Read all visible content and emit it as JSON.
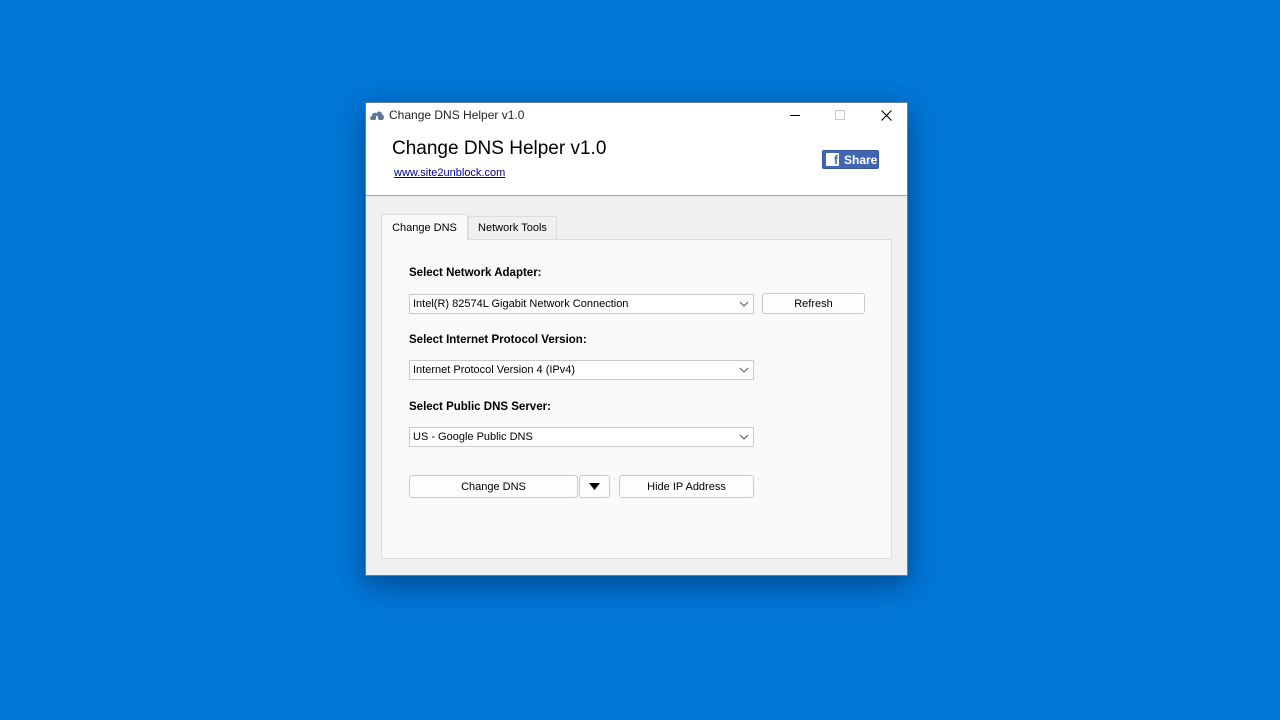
{
  "window": {
    "title": "Change DNS Helper v1.0",
    "icon": "cloud-icon",
    "controls": {
      "minimize": "minimize-icon",
      "maximize": "maximize-icon",
      "close": "close-icon"
    }
  },
  "header": {
    "title": "Change DNS Helper v1.0",
    "link": "www.site2unblock.com",
    "share_label": "Share",
    "share_icon": "facebook-icon",
    "share_color": "#4267b2"
  },
  "tabs": [
    {
      "label": "Change DNS",
      "active": true
    },
    {
      "label": "Network Tools",
      "active": false
    }
  ],
  "form": {
    "adapter_label": "Select Network Adapter:",
    "adapter_value": "Intel(R) 82574L Gigabit Network Connection",
    "refresh_label": "Refresh",
    "protocol_label": "Select Internet Protocol Version:",
    "protocol_value": "Internet Protocol Version 4 (IPv4)",
    "dns_label": "Select Public DNS Server:",
    "dns_value": "US - Google Public DNS",
    "change_dns_label": "Change DNS",
    "dropdown_icon": "triangle-down-icon",
    "hide_ip_label": "Hide IP Address"
  },
  "colors": {
    "desktop": "#0078d7",
    "link": "#00008b"
  }
}
